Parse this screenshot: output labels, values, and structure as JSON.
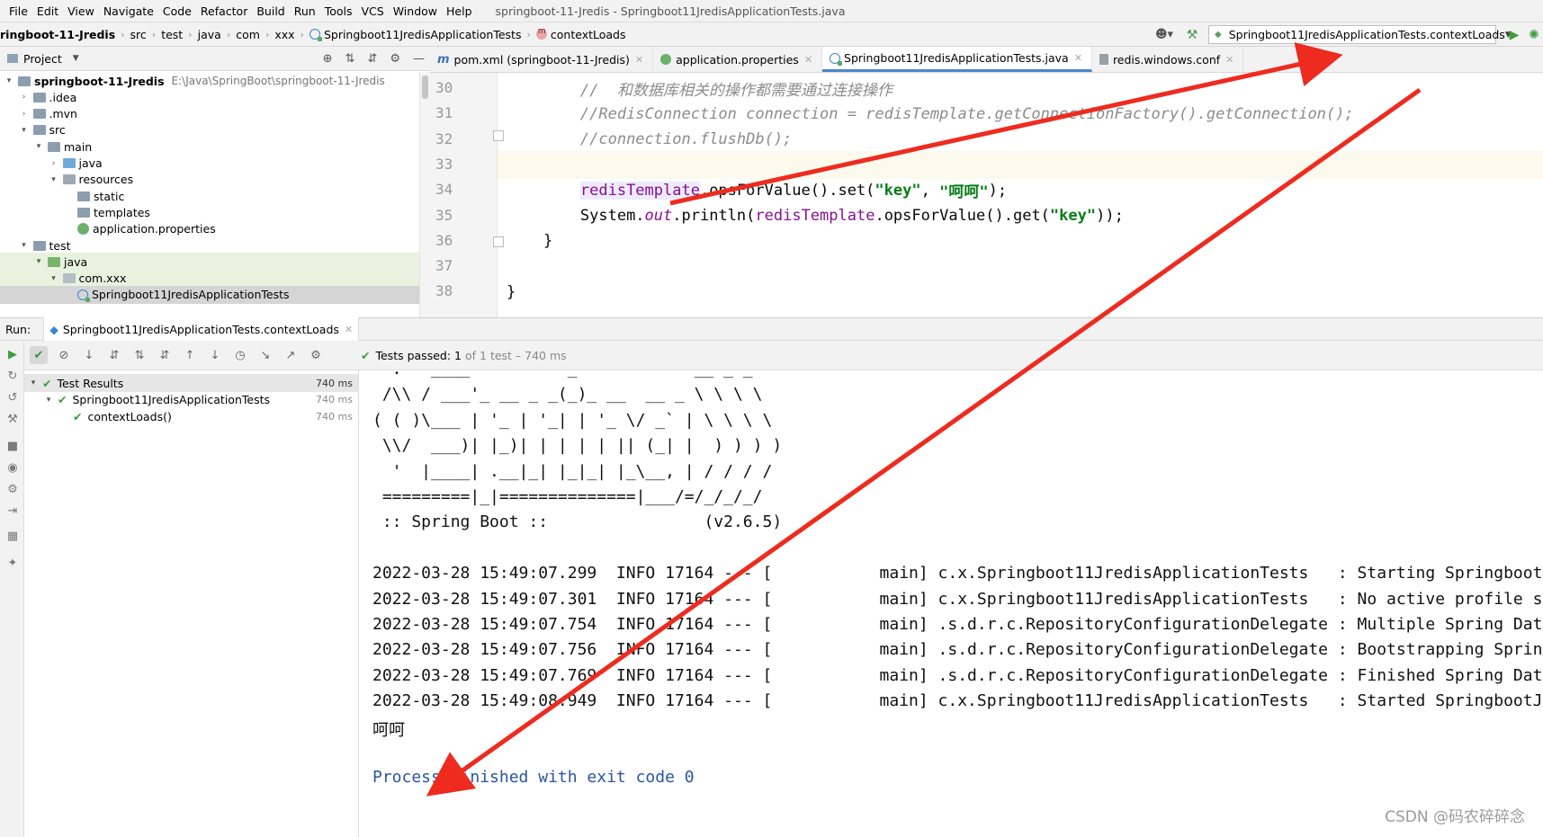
{
  "menu": {
    "items": [
      "File",
      "Edit",
      "View",
      "Navigate",
      "Code",
      "Refactor",
      "Build",
      "Run",
      "Tools",
      "VCS",
      "Window",
      "Help"
    ],
    "mnemonics": [
      "F",
      "E",
      "V",
      "N",
      "C",
      "R",
      "B",
      "u",
      "T",
      "S",
      "W",
      "H"
    ],
    "window_title": "springboot-11-Jredis - Springboot11JredisApplicationTests.java"
  },
  "nav": {
    "crumbs": [
      "ringboot-11-Jredis",
      "src",
      "test",
      "java",
      "com",
      "xxx",
      "Springboot11JredisApplicationTests",
      "contextLoads"
    ],
    "run_config": "Springboot11JredisApplicationTests.contextLoads"
  },
  "project": {
    "title": "Project",
    "tree": [
      {
        "label": "springboot-11-Jredis",
        "path": "E:\\Java\\SpringBoot\\springboot-11-Jredis",
        "depth": 0,
        "arrow": "▾",
        "icon": "folder",
        "bold": true
      },
      {
        "label": ".idea",
        "depth": 1,
        "arrow": "›",
        "icon": "folder"
      },
      {
        "label": ".mvn",
        "depth": 1,
        "arrow": "›",
        "icon": "folder"
      },
      {
        "label": "src",
        "depth": 1,
        "arrow": "▾",
        "icon": "folder"
      },
      {
        "label": "main",
        "depth": 2,
        "arrow": "▾",
        "icon": "folder"
      },
      {
        "label": "java",
        "depth": 3,
        "arrow": "›",
        "icon": "folder-blue"
      },
      {
        "label": "resources",
        "depth": 3,
        "arrow": "▾",
        "icon": "folder-res"
      },
      {
        "label": "static",
        "depth": 4,
        "arrow": "",
        "icon": "folder"
      },
      {
        "label": "templates",
        "depth": 4,
        "arrow": "",
        "icon": "folder"
      },
      {
        "label": "application.properties",
        "depth": 4,
        "arrow": "",
        "icon": "props"
      },
      {
        "label": "test",
        "depth": 1,
        "arrow": "▾",
        "icon": "folder"
      },
      {
        "label": "java",
        "depth": 2,
        "arrow": "▾",
        "icon": "folder-green",
        "selected": true
      },
      {
        "label": "com.xxx",
        "depth": 3,
        "arrow": "▾",
        "icon": "folder-pkg",
        "selected": true
      },
      {
        "label": "Springboot11JredisApplicationTests",
        "depth": 4,
        "arrow": "",
        "icon": "class",
        "selected2": true
      }
    ]
  },
  "editor": {
    "tabs": [
      {
        "label": "pom.xml (springboot-11-Jredis)",
        "icon": "maven"
      },
      {
        "label": "application.properties",
        "icon": "leaf"
      },
      {
        "label": "Springboot11JredisApplicationTests.java",
        "icon": "class",
        "active": true
      },
      {
        "label": "redis.windows.conf",
        "icon": "conf"
      }
    ],
    "lines": [
      {
        "no": "30",
        "parts": [
          {
            "t": "        ",
            "c": "plain"
          },
          {
            "t": "//  和数据库相关的操作都需要通过连接操作",
            "c": "cmt"
          }
        ]
      },
      {
        "no": "31",
        "parts": [
          {
            "t": "        ",
            "c": "plain"
          },
          {
            "t": "//RedisConnection connection = redisTemplate.getConnectionFactory().getConnection();",
            "c": "cmt"
          }
        ]
      },
      {
        "no": "32",
        "parts": [
          {
            "t": "        ",
            "c": "plain"
          },
          {
            "t": "//connection.flushDb();",
            "c": "cmt"
          }
        ]
      },
      {
        "no": "33",
        "parts": [
          {
            "t": "",
            "c": "plain"
          }
        ],
        "highlight": true
      },
      {
        "no": "34",
        "parts": [
          {
            "t": "        ",
            "c": "plain"
          },
          {
            "t": "redisTemplate",
            "c": "fld-hl"
          },
          {
            "t": ".opsForValue().set(",
            "c": "plain"
          },
          {
            "t": "\"key\"",
            "c": "str"
          },
          {
            "t": ", ",
            "c": "plain"
          },
          {
            "t": "\"呵呵\"",
            "c": "str"
          },
          {
            "t": ");",
            "c": "plain"
          }
        ]
      },
      {
        "no": "35",
        "parts": [
          {
            "t": "        ",
            "c": "plain"
          },
          {
            "t": "System.",
            "c": "plain"
          },
          {
            "t": "out",
            "c": "static-f"
          },
          {
            "t": ".println(",
            "c": "plain"
          },
          {
            "t": "redisTemplate",
            "c": "fld"
          },
          {
            "t": ".opsForValue().get(",
            "c": "plain"
          },
          {
            "t": "\"key\"",
            "c": "str"
          },
          {
            "t": "));",
            "c": "plain"
          }
        ]
      },
      {
        "no": "36",
        "parts": [
          {
            "t": "    }",
            "c": "plain"
          }
        ]
      },
      {
        "no": "37",
        "parts": [
          {
            "t": "",
            "c": "plain"
          }
        ]
      },
      {
        "no": "38",
        "parts": [
          {
            "t": "}",
            "c": "plain"
          }
        ]
      }
    ]
  },
  "run": {
    "label": "Run:",
    "tab": "Springboot11JredisApplicationTests.contextLoads",
    "status_prefix": "Tests passed:",
    "status_count": "1",
    "status_rest": "of 1 test – 740 ms",
    "results": [
      {
        "label": "Test Results",
        "time": "740 ms",
        "depth": 0,
        "arrow": "▾",
        "selected": true
      },
      {
        "label": "Springboot11JredisApplicationTests",
        "time": "740 ms",
        "depth": 1,
        "arrow": "▾"
      },
      {
        "label": "contextLoads()",
        "time": "740 ms",
        "depth": 2,
        "arrow": ""
      }
    ],
    "console": [
      "  .   ____          _            __ _ _",
      " /\\\\ / ___'_ __ _ _(_)_ __  __ _ \\ \\ \\ \\",
      "( ( )\\___ | '_ | '_| | '_ \\/ _` | \\ \\ \\ \\",
      " \\\\/  ___)| |_)| | | | | || (_| |  ) ) ) )",
      "  '  |____| .__|_| |_|_| |_\\__, | / / / /",
      " =========|_|==============|___/=/_/_/_/",
      " :: Spring Boot ::                (v2.6.5)",
      "",
      "2022-03-28 15:49:07.299  INFO 17164 --- [           main] c.x.Springboot11JredisApplicationTests   : Starting SpringbootJredisApp",
      "2022-03-28 15:49:07.301  INFO 17164 --- [           main] c.x.Springboot11JredisApplicationTests   : No active profile set",
      "2022-03-28 15:49:07.754  INFO 17164 --- [           main] .s.d.r.c.RepositoryConfigurationDelegate : Multiple Spring Data",
      "2022-03-28 15:49:07.756  INFO 17164 --- [           main] .s.d.r.c.RepositoryConfigurationDelegate : Bootstrapping Spring",
      "2022-03-28 15:49:07.769  INFO 17164 --- [           main] .s.d.r.c.RepositoryConfigurationDelegate : Finished Spring Data",
      "2022-03-28 15:49:08.949  INFO 17164 --- [           main] c.x.Springboot11JredisApplicationTests   : Started SpringbootJredis",
      "呵呵",
      "",
      "Process finished with exit code 0"
    ]
  },
  "watermark": "CSDN @码农碎碎念",
  "colors": {
    "accent": "#4a88c7",
    "pass": "#3d9e3d",
    "annotation_arrow": "#ee2b1f",
    "string": "#067d17",
    "field": "#871094",
    "comment": "#8c8c8c"
  }
}
